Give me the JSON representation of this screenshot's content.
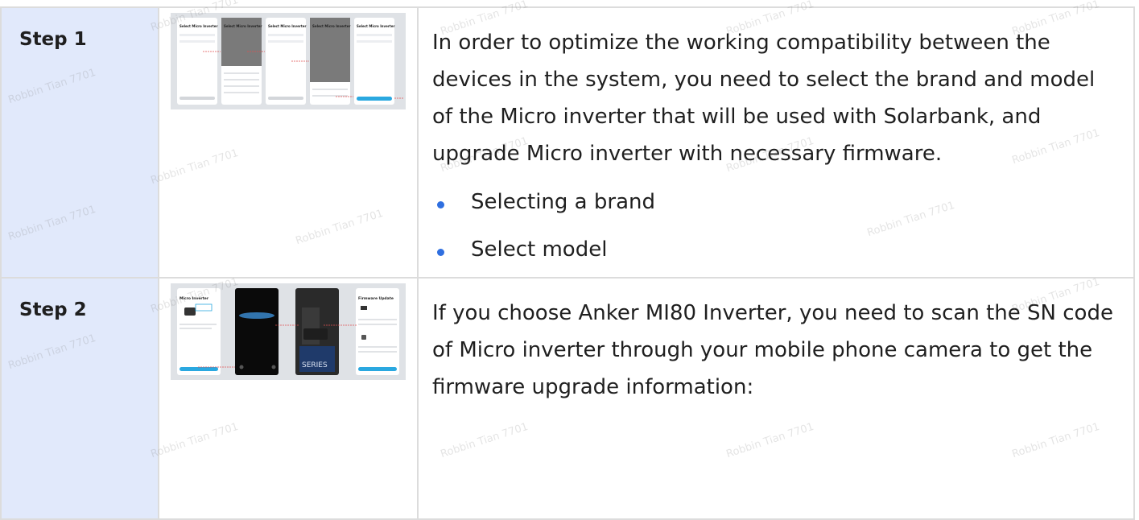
{
  "watermark": "Robbin Tian 7701",
  "steps": [
    {
      "label": "Step 1",
      "text": "In order to optimize the working compatibility between the devices in the system, you need to select the brand and model of the Micro inverter that will be used with Solarbank, and upgrade Micro inverter with necessary firmware.",
      "bullets": [
        "Selecting a brand",
        "Select model"
      ],
      "image": {
        "screen_titles": [
          "Select Micro Inverter",
          "Select Micro Inverter",
          "Select Micro Inverter",
          "Select Micro Inverter",
          "Select Micro Inverter"
        ]
      }
    },
    {
      "label": "Step 2",
      "text": "If you choose Anker MI80 Inverter, you need to scan the SN code of Micro inverter through your mobile phone camera to get the firmware upgrade information:",
      "image": {
        "screen_titles": [
          "Micro Inverter",
          "",
          "",
          "Firmware Update"
        ],
        "series_label": "SERIES"
      }
    }
  ],
  "colors": {
    "label_bg": "#e1e9fb",
    "bullet": "#2f6fe0",
    "border": "#dcdcdc",
    "app_blue": "#2aa8e0"
  }
}
